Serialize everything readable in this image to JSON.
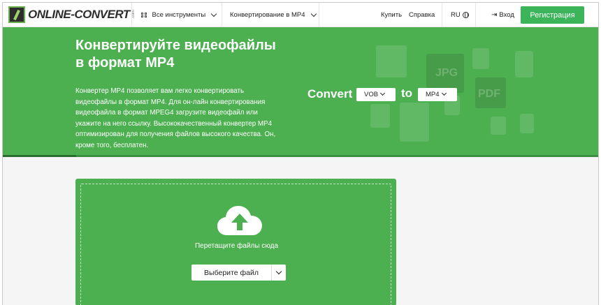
{
  "header": {
    "logo_text": "ONLINE-CONVERT",
    "logo_suffix": ".com",
    "all_tools": "Все инструменты",
    "category": "Конвертирование в MP4",
    "buy": "Купить",
    "help": "Справка",
    "language": "RU",
    "login": "Вход",
    "register": "Регистрация"
  },
  "hero": {
    "title_line1": "Конвертируйте видеофайлы",
    "title_line2": "в формат MP4",
    "description": "Конвертер MP4 позволяет вам легко конвертировать видеофайлы в формат MP4. Для он-лайн конвертирования видеофайла в формат MPEG4 загрузите видеофайл или укажите на него ссылку. Высококачественный конвертер MP4 оптимизирован для получения файлов высокого качества. Он, кроме того, бесплатен.",
    "convert_label": "Convert",
    "from_format": "VOB",
    "to_label": "to",
    "to_format": "MP4",
    "bg_labels": [
      "JPG",
      "PDF"
    ]
  },
  "upload": {
    "drop_text": "Перетащите файлы сюда",
    "choose_button": "Выберите файл"
  },
  "colors": {
    "brand_green": "#4caf50",
    "register_green": "#3cb55a"
  },
  "icons": [
    "grid-icon",
    "chevron-down-icon",
    "globe-icon",
    "login-icon",
    "cloud-upload-icon"
  ]
}
